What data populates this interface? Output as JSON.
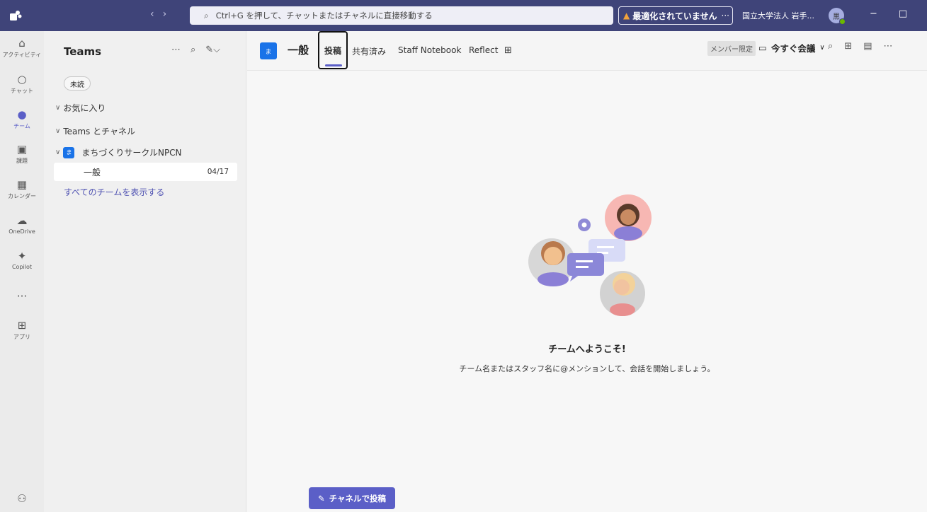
{
  "titlebar": {
    "search_placeholder": "Ctrl+G を押して、チャットまたはチャネルに直接移動する",
    "warning": "最適化されていません",
    "warning_more": "···",
    "org": "国立大学法人 岩手...",
    "avatar_initial": "黒"
  },
  "rail": {
    "activity": "アクティビティ",
    "chat": "チャット",
    "teams": "チーム",
    "assignments": "課題",
    "calendar": "カレンダー",
    "onedrive": "OneDrive",
    "copilot": "Copilot",
    "more": "···",
    "apps": "アプリ"
  },
  "sidebar": {
    "title": "Teams",
    "unread_chip": "未読",
    "favorites": "お気に入り",
    "teams_and_channels": "Teams とチャネル",
    "team_badge": "ま",
    "team_name": "まちづくりサークルNPCN",
    "channel_name": "一般",
    "channel_date": "04/17",
    "show_all_teams": "すべてのチームを表示する"
  },
  "header": {
    "badge": "ま",
    "channel_title": "一般",
    "tabs": [
      "投稿",
      "共有済み",
      "Staff Notebook",
      "Reflect"
    ],
    "members_only": "メンバー限定",
    "meet_now": "今すぐ会議"
  },
  "main": {
    "welcome_title": "チームへようこそ!",
    "welcome_sub": "チーム名またはスタッフ名に@メンションして、会話を開始しましょう。",
    "post_button": "チャネルで投稿"
  },
  "colors": {
    "titlebar": "#3f4479",
    "accent": "#5b5fc7",
    "team_badge": "#1a73e8"
  }
}
